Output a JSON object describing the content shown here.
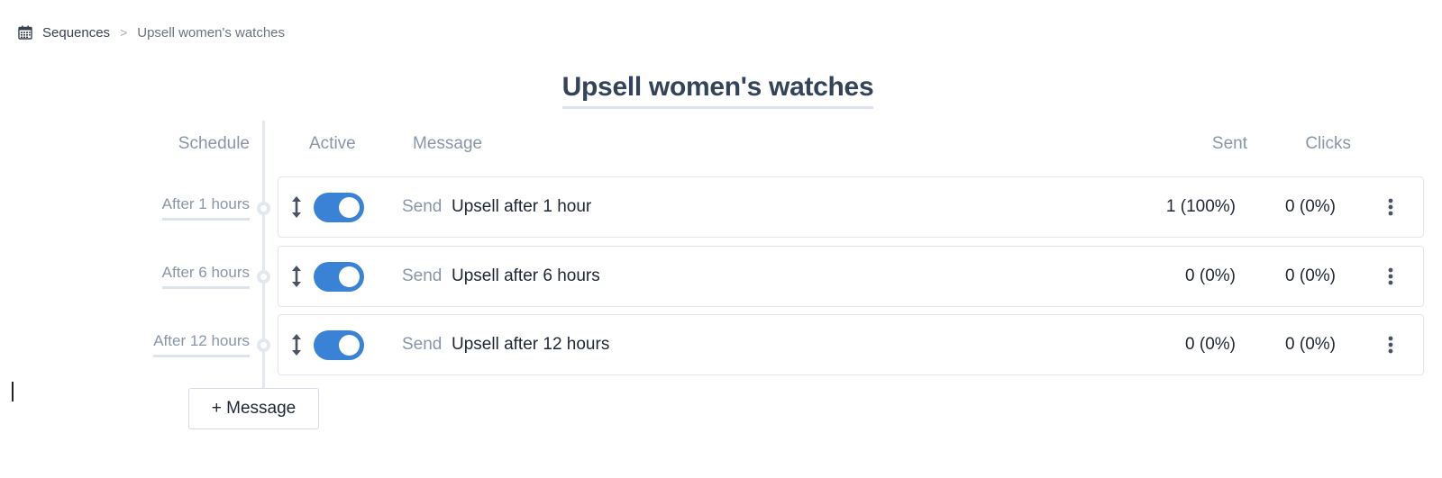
{
  "breadcrumb": {
    "icon": "calendar-icon",
    "parent": "Sequences",
    "separator": ">",
    "current": "Upsell women's watches"
  },
  "title": "Upsell women's watches",
  "columns": {
    "schedule": "Schedule",
    "active": "Active",
    "message": "Message",
    "sent": "Sent",
    "clicks": "Clicks"
  },
  "rows": [
    {
      "schedule": "After 1 hours",
      "active": true,
      "action": "Send",
      "message": "Upsell after 1 hour",
      "sent": "1 (100%)",
      "clicks": "0 (0%)"
    },
    {
      "schedule": "After 6 hours",
      "active": true,
      "action": "Send",
      "message": "Upsell after 6 hours",
      "sent": "0 (0%)",
      "clicks": "0 (0%)"
    },
    {
      "schedule": "After 12 hours",
      "active": true,
      "action": "Send",
      "message": "Upsell after 12 hours",
      "sent": "0 (0%)",
      "clicks": "0 (0%)"
    }
  ],
  "add_button": "+ Message",
  "colors": {
    "toggle_on": "#3a82d6",
    "title": "#34425a",
    "muted": "#8a96a8",
    "timeline": "#e3e8ef"
  }
}
